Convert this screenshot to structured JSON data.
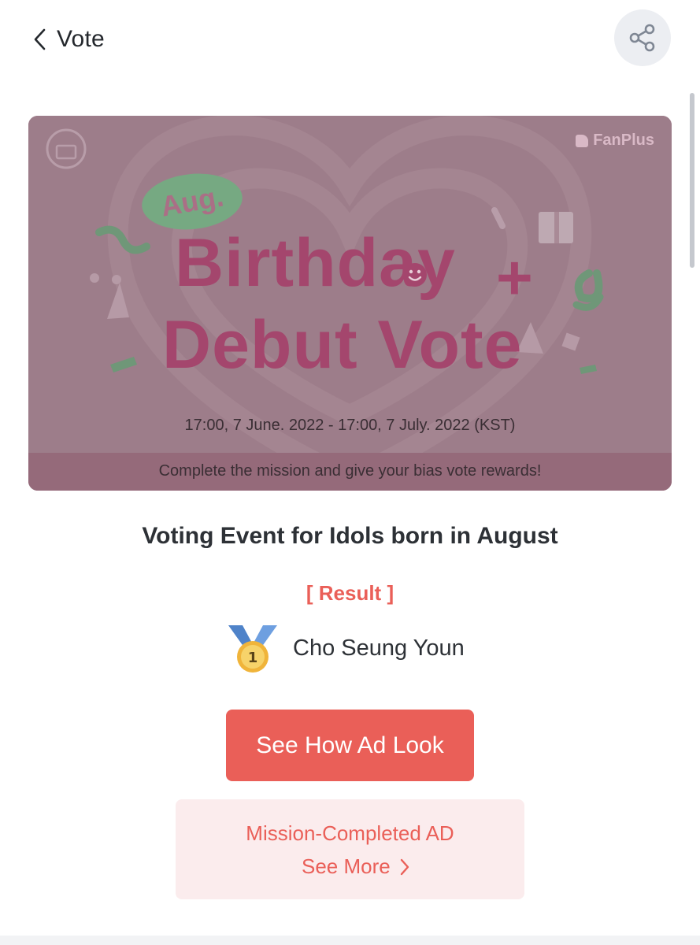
{
  "header": {
    "back_label": "Vote",
    "back_icon": "chevron-left-icon",
    "share_icon": "share-icon"
  },
  "banner": {
    "brand": "FanPlus",
    "tag": "Aug.",
    "title_line1": "Birthday",
    "title_plus": "+",
    "title_line2": "Debut Vote",
    "date_range": "17:00, 7 June. 2022 - 17:00, 7 July. 2022 (KST)",
    "footer_text": "Complete the mission and give your bias vote rewards!"
  },
  "event": {
    "title": "Voting Event for Idols born in August",
    "result_label": "[ Result ]",
    "winner_rank": "1",
    "winner_name": "Cho Seung Youn"
  },
  "actions": {
    "primary_label": "See How Ad Look",
    "mission_title": "Mission-Completed AD",
    "mission_more": "See More"
  },
  "colors": {
    "accent": "#ea5f58",
    "card_bg": "#fbeced",
    "banner_title": "#a4466d",
    "banner_tag": "#76a982"
  }
}
